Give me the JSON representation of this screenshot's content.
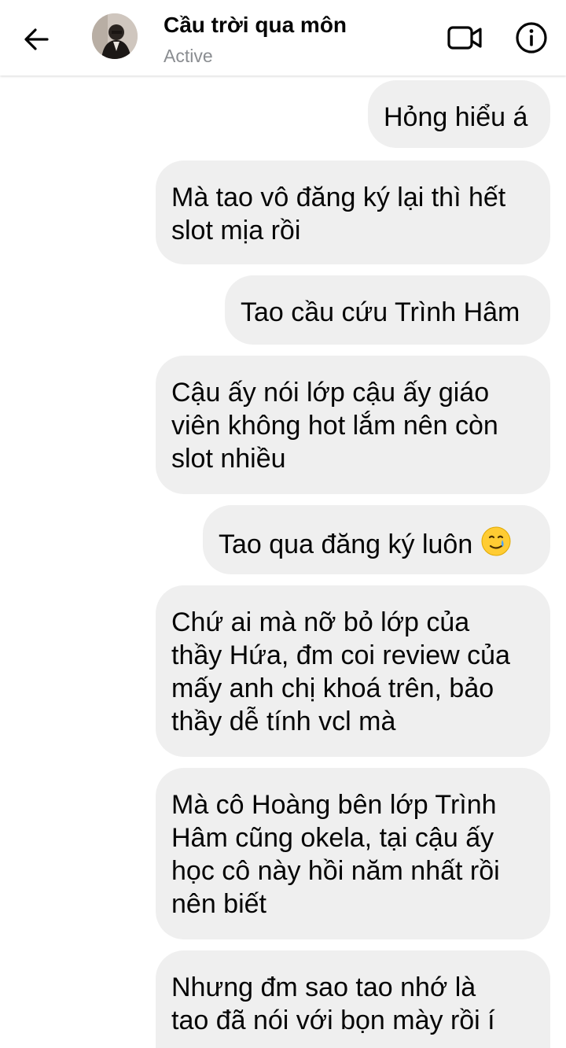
{
  "header": {
    "contact_name": "Cầu trời qua môn",
    "status": "Active",
    "back_icon": "arrow-left-icon",
    "video_icon": "video-camera-icon",
    "info_icon": "info-icon"
  },
  "messages": [
    {
      "lines": [
        "Hỏng hiểu á"
      ]
    },
    {
      "lines": [
        "Mà tao vô đăng ký lại thì hết",
        "slot mịa rồi"
      ]
    },
    {
      "lines": [
        "Tao cầu cứu Trình Hâm"
      ]
    },
    {
      "lines": [
        "Cậu ấy nói lớp cậu ấy giáo",
        "viên không hot lắm nên còn",
        "slot nhiều"
      ]
    },
    {
      "lines": [
        "Tao qua đăng ký luôn"
      ],
      "emoji": "smiling-face-with-tear"
    },
    {
      "lines": [
        "Chứ ai mà nỡ bỏ lớp của",
        "thầy Hứa, đm coi review của",
        "mấy anh chị khoá trên, bảo",
        "thầy dễ tính vcl mà"
      ]
    },
    {
      "lines": [
        "Mà cô Hoàng bên lớp Trình",
        "Hâm cũng okela, tại cậu ấy",
        "học cô này hồi năm nhất rồi",
        "nên biết"
      ]
    },
    {
      "lines": [
        "Nhưng đm sao tao nhớ là",
        "tao đã nói với bọn mày rồi í"
      ]
    }
  ],
  "colors": {
    "bubble_bg": "#efefef",
    "status_text": "#8a8d91",
    "text": "#050505"
  }
}
